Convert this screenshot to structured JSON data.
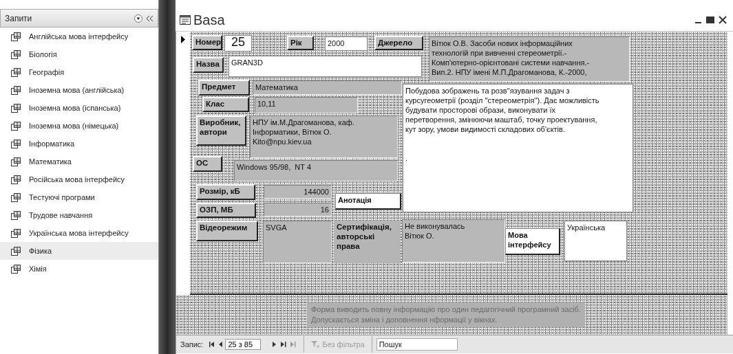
{
  "sidebar": {
    "title": "Запити",
    "items": [
      {
        "label": "Англійська мова інтерфейсу",
        "selected": false
      },
      {
        "label": "Біологія",
        "selected": false
      },
      {
        "label": "Географія",
        "selected": false
      },
      {
        "label": "Іноземна мова (англійська)",
        "selected": false
      },
      {
        "label": "Іноземна мова (іспанська)",
        "selected": false
      },
      {
        "label": "Іноземна мова (німецька)",
        "selected": false
      },
      {
        "label": "Інформатика",
        "selected": false
      },
      {
        "label": "Математика",
        "selected": false
      },
      {
        "label": "Російська мова інтерфейсу",
        "selected": false
      },
      {
        "label": "Тестуючі програми",
        "selected": false
      },
      {
        "label": "Трудове навчання",
        "selected": false
      },
      {
        "label": "Українська мова інтерфейсу",
        "selected": false
      },
      {
        "label": "Фізика",
        "selected": true
      },
      {
        "label": "Хімія",
        "selected": false
      }
    ]
  },
  "window": {
    "title": "Basa"
  },
  "form": {
    "controls": [
      {
        "kind": "button",
        "text": "Номер"
      },
      {
        "kind": "white-field",
        "text": "25"
      },
      {
        "kind": "button",
        "text": "Рік"
      },
      {
        "kind": "white-field",
        "text": "2000"
      },
      {
        "kind": "button",
        "text": "Джерело"
      },
      {
        "kind": "gray-field",
        "text": "Вітюк О.В. Засоби нових інформаційних\nтехнологій при вивченні стереометрії.-\nКомп'ютерно-орієнтовані системи навчання.-\nВип.2. НПУ імені М.П.Драгоманова, К.-2000,"
      },
      {
        "kind": "button",
        "text": "Назва"
      },
      {
        "kind": "white-field",
        "text": "GRAN3D"
      },
      {
        "kind": "button",
        "text": "Предмет"
      },
      {
        "kind": "gray-field",
        "text": "Математика"
      },
      {
        "kind": "white-field",
        "text": "Побудова зображень та розв''язування задач з\nкурсугеометрії (розділ ''стереометрія''). Дає можливість\nбудувати просторові образи, виконувати їх\nперетворення, змінюючи маштаб, точку проектування,\nкут зору, умови видимості складових об'єктів.\n\n\n."
      },
      {
        "kind": "button",
        "text": "Клас"
      },
      {
        "kind": "gray-field",
        "text": "10,11"
      },
      {
        "kind": "button",
        "text": "Виробник,\nавтори"
      },
      {
        "kind": "gray-field",
        "text": "НПУ ім.М.Драгоманова, каф.\nІнформатики, Вітюк О.\nKito@npu.kiev.ua"
      },
      {
        "kind": "button",
        "text": "ОС"
      },
      {
        "kind": "gray-field",
        "text": "Windows 95/98,  NT 4"
      },
      {
        "kind": "button",
        "text": "Розмір, кБ"
      },
      {
        "kind": "gray-field",
        "text": "144000"
      },
      {
        "kind": "white-label",
        "text": "Анотація"
      },
      {
        "kind": "button",
        "text": "ОЗП, МБ"
      },
      {
        "kind": "gray-field",
        "text": "16"
      },
      {
        "kind": "button",
        "text": "Відеорежим"
      },
      {
        "kind": "gray-field",
        "text": "SVGA"
      },
      {
        "kind": "caption",
        "text": "Сертифікація,\nавторські\nправа"
      },
      {
        "kind": "gray-field",
        "text": "Не виконувалась\nВітюк О."
      },
      {
        "kind": "white-label",
        "text": "Мова\nінтерфейсу"
      },
      {
        "kind": "white-field",
        "text": "Українська"
      }
    ],
    "note": "Форма виводить повну інформацію про один педагогічний програмний засіб.\nДопускається зміна і доповнення нформації у вікнах."
  },
  "navigation": {
    "label": "Запис:",
    "position": "25 з 85",
    "filter": {
      "label": "Без фільтра",
      "disabled": true
    },
    "search": {
      "placeholder": "Пошук"
    }
  }
}
